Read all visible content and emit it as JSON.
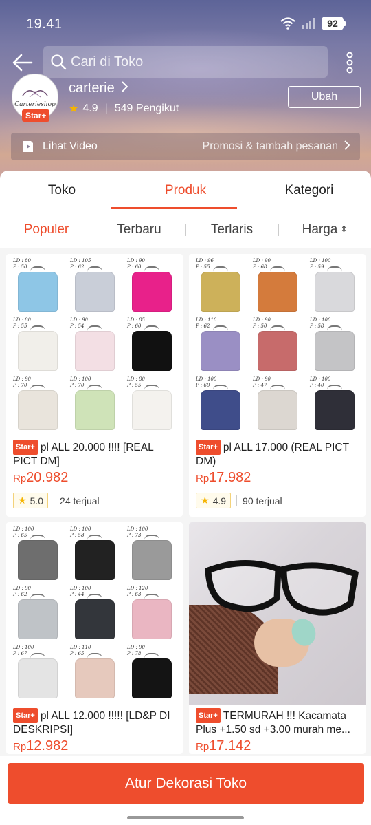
{
  "status_bar": {
    "time": "19.41",
    "battery": "92"
  },
  "search": {
    "placeholder": "Cari di Toko"
  },
  "shop": {
    "name": "carterie",
    "logo_text": "Carterieshop",
    "badge": "Star+",
    "rating": "4.9",
    "followers": "549 Pengikut",
    "edit_label": "Ubah"
  },
  "video_bar": {
    "label": "Lihat Video",
    "promo": "Promosi & tambah pesanan"
  },
  "tabs": [
    {
      "label": "Toko"
    },
    {
      "label": "Produk",
      "active": true
    },
    {
      "label": "Kategori"
    }
  ],
  "sort": [
    {
      "label": "Populer",
      "active": true
    },
    {
      "label": "Terbaru"
    },
    {
      "label": "Terlaris"
    },
    {
      "label": "Harga"
    }
  ],
  "products": [
    {
      "badge": "Star+",
      "title": "pl ALL 20.000 !!!! [REAL PICT DM]",
      "currency": "Rp",
      "price": "20.982",
      "rating": "5.0",
      "sold": "24 terjual"
    },
    {
      "badge": "Star+",
      "title": "pl ALL 17.000 (REAL PICT DM)",
      "currency": "Rp",
      "price": "17.982",
      "rating": "4.9",
      "sold": "90 terjual"
    },
    {
      "badge": "Star+",
      "title": "pl ALL 12.000 !!!!! [LD&P DI DESKRIPSI]",
      "currency": "Rp",
      "price": "12.982"
    },
    {
      "badge": "Star+",
      "title": "TERMURAH !!! Kacamata Plus +1.50 sd +3.00 murah me...",
      "currency": "Rp",
      "price": "17.142"
    }
  ],
  "thumbnails": {
    "p1": [
      {
        "tag": "LD : 80\nP : 50",
        "color": "#8ec6e6"
      },
      {
        "tag": "LD : 105\nP : 62",
        "color": "#c9ced8"
      },
      {
        "tag": "LD : 90\nP : 60",
        "color": "#e8218a"
      },
      {
        "tag": "LD : 80\nP : 55",
        "color": "#f1efea"
      },
      {
        "tag": "LD : 90\nP : 54",
        "color": "#f3dfe4"
      },
      {
        "tag": "LD : 85\nP : 60",
        "color": "#111111"
      },
      {
        "tag": "LD : 90\nP : 70",
        "color": "#e9e4dc"
      },
      {
        "tag": "LD : 100\nP : 70",
        "color": "#cfe3b8"
      },
      {
        "tag": "LD : 80\nP : 55",
        "color": "#f4f2ee"
      }
    ],
    "p2": [
      {
        "tag": "LD : 96\nP : 55",
        "color": "#cdb15a"
      },
      {
        "tag": "LD : 90\nP : 68",
        "color": "#d47b3c"
      },
      {
        "tag": "LD : 100\nP : 59",
        "color": "#d9d9dc"
      },
      {
        "tag": "LD : 110\nP : 62",
        "color": "#9a8fc4"
      },
      {
        "tag": "LD : 90\nP : 50",
        "color": "#c76b6b"
      },
      {
        "tag": "LD : 100\nP : 58",
        "color": "#c4c4c6"
      },
      {
        "tag": "LD : 100\nP : 60",
        "color": "#3f4d8a"
      },
      {
        "tag": "LD : 90\nP : 47",
        "color": "#dcd7d1"
      },
      {
        "tag": "LD : 100\nP : 40",
        "color": "#2f2f38"
      }
    ],
    "p3": [
      {
        "tag": "LD : 100\nP : 65",
        "color": "#6e6e6e"
      },
      {
        "tag": "LD : 100\nP : 58",
        "color": "#222222"
      },
      {
        "tag": "LD : 100\nP : 73",
        "color": "#9a9a9a"
      },
      {
        "tag": "LD : 90\nP : 62",
        "color": "#bfc3c7"
      },
      {
        "tag": "LD : 100\nP : 44",
        "color": "#33363b"
      },
      {
        "tag": "LD : 120\nP : 63",
        "color": "#eab6c2"
      },
      {
        "tag": "LD : 100\nP : 67",
        "color": "#e4e4e4"
      },
      {
        "tag": "LD : 110\nP : 65",
        "color": "#e6c9bd"
      },
      {
        "tag": "LD : 90\nP : 78",
        "color": "#141414"
      }
    ]
  },
  "bottom_action": {
    "label": "Atur Dekorasi Toko"
  },
  "colors": {
    "accent": "#ee4d2d",
    "rating_star": "#f5b400"
  }
}
